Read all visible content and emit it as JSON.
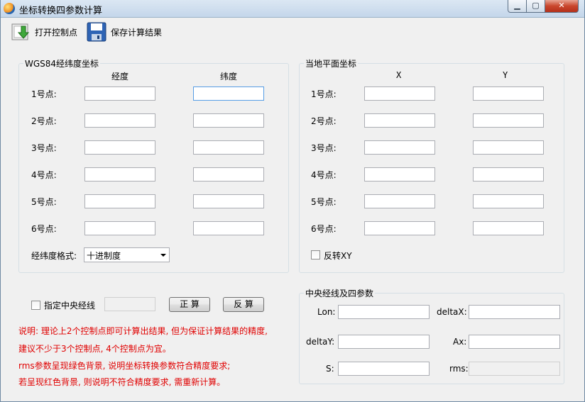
{
  "window": {
    "title": "坐标转换四参数计算"
  },
  "toolbar": {
    "open": "打开控制点",
    "save": "保存计算结果"
  },
  "wgs": {
    "legend": "WGS84经纬度坐标",
    "col_lon": "经度",
    "col_lat": "纬度",
    "rows": [
      "1号点:",
      "2号点:",
      "3号点:",
      "4号点:",
      "5号点:",
      "6号点:"
    ],
    "format_label": "经纬度格式:",
    "format_value": "十进制度"
  },
  "local": {
    "legend": "当地平面坐标",
    "col_x": "X",
    "col_y": "Y",
    "rows": [
      "1号点:",
      "2号点:",
      "3号点:",
      "4号点:",
      "5号点:",
      "6号点:"
    ],
    "reverse_xy": "反转XY"
  },
  "central": {
    "specify_label": "指定中央经线",
    "forward": "正 算",
    "backward": "反 算"
  },
  "params": {
    "legend": "中央经线及四参数",
    "lon": "Lon:",
    "deltaX": "deltaX:",
    "deltaY": "deltaY:",
    "ax": "Ax:",
    "s": "S:",
    "rms": "rms:"
  },
  "notes": [
    "说明: 理论上2个控制点即可计算出结果, 但为保证计算结果的精度,",
    "建议不少于3个控制点, 4个控制点为宜。",
    "rms参数呈现绿色背景, 说明坐标转换参数符合精度要求;",
    "若呈现红色背景, 则说明不符合精度要求, 需重新计算。"
  ]
}
